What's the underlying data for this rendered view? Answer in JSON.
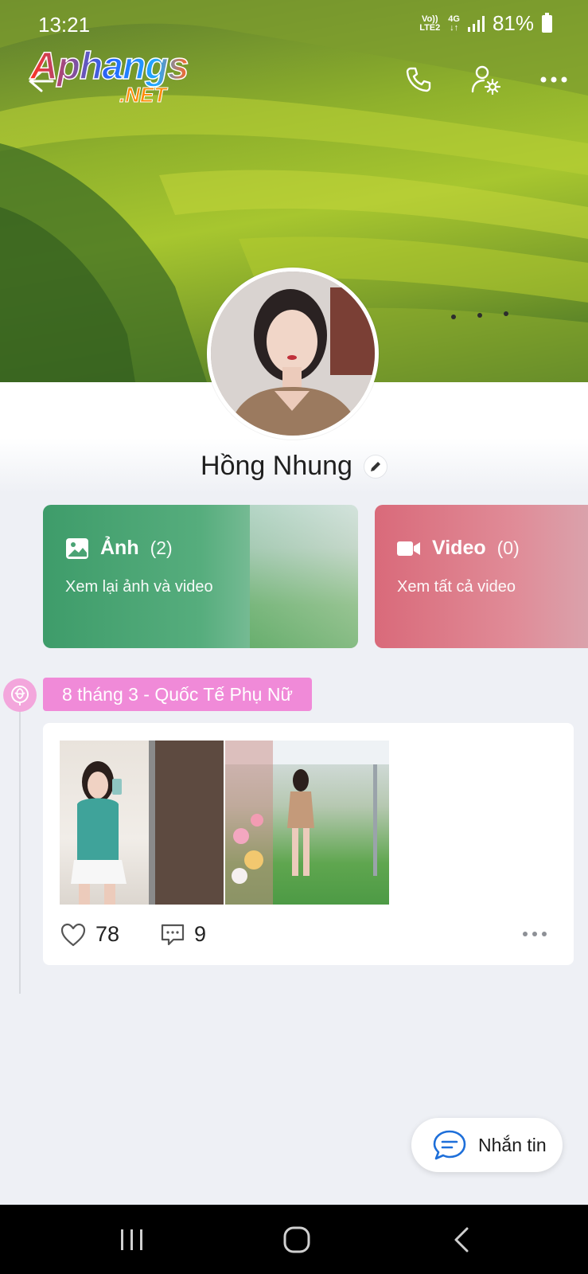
{
  "status_bar": {
    "time": "13:21",
    "network_line1": "Vo))",
    "network_line2": "LTE2",
    "network_type": "4G",
    "battery": "81%"
  },
  "watermark": {
    "line1": "Aphangs",
    "line2": ".NET"
  },
  "profile": {
    "name": "Hồng Nhung"
  },
  "media_cards": {
    "photo": {
      "title": "Ảnh",
      "count": "(2)",
      "subtitle": "Xem lại ảnh và video"
    },
    "video": {
      "title": "Video",
      "count": "(0)",
      "subtitle": "Xem tất cả video"
    }
  },
  "timeline": {
    "tag": "8 tháng 3 - Quốc Tế Phụ Nữ",
    "post": {
      "likes": "78",
      "comments": "9"
    }
  },
  "message_button": {
    "label": "Nhắn tin"
  },
  "icons": {
    "back": "back-arrow-icon",
    "call": "phone-icon",
    "settings": "user-settings-icon",
    "more": "more-horizontal-icon",
    "photo": "image-icon",
    "video": "video-camera-icon",
    "rose": "rose-icon",
    "like": "heart-icon",
    "comment": "comment-icon",
    "message": "chat-bubble-icon"
  },
  "colors": {
    "photo_card": "#3e9c6a",
    "video_card": "#d96a7a",
    "tag": "#f08ad8",
    "accent_blue": "#1e6fd9"
  }
}
